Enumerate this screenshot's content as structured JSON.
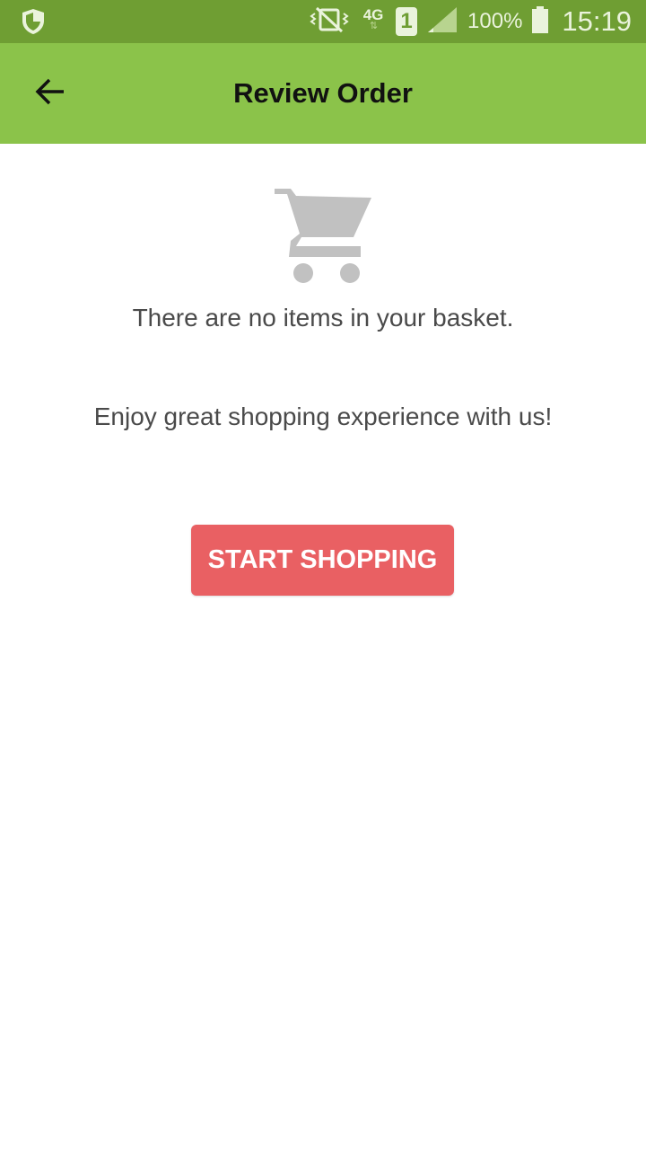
{
  "status_bar": {
    "left_icon": "shield-icon",
    "network_type": "4G",
    "sim_slot": "1",
    "battery_percent": "100%",
    "time": "15:19",
    "icons": [
      "vibrate-mute-icon",
      "network-4g-icon",
      "sim-1-icon",
      "signal-icon",
      "battery-icon"
    ]
  },
  "app_bar": {
    "title": "Review Order",
    "back_icon": "arrow-back-icon",
    "color": "#8bc34a"
  },
  "empty_state": {
    "icon": "shopping-cart-icon",
    "message": "There are no items in your basket.",
    "tagline": "Enjoy great shopping experience with us!",
    "button_label": "START SHOPPING",
    "button_color": "#e96063"
  }
}
